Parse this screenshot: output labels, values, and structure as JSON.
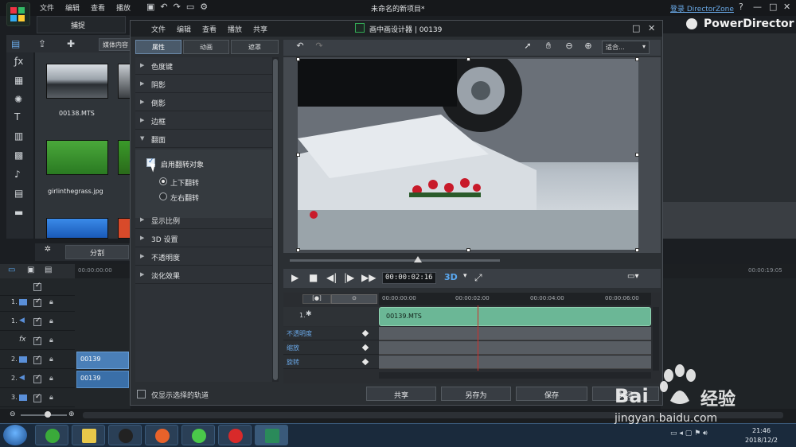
{
  "app": {
    "menu": [
      "文件",
      "编辑",
      "查看",
      "播放"
    ],
    "title": "未命名的新项目*",
    "login": "登录 DirectorZone",
    "brand": "PowerDirector",
    "help": "?",
    "minimize": "—",
    "restore": "□",
    "close": "✕",
    "capture_tab": "捕捉",
    "media_content": "媒体内容",
    "split": "分割"
  },
  "library": {
    "items": [
      {
        "label": "00138.MTS"
      },
      {
        "label": "girlinthegrass.jpg"
      }
    ]
  },
  "timeline": {
    "ruler_start": "00:00:00:00",
    "ruler_end": "00:00:19:05",
    "tracks": [
      {
        "num": "1."
      },
      {
        "num": "1."
      },
      {
        "num": ""
      },
      {
        "num": "2."
      },
      {
        "num": "2."
      },
      {
        "num": "3."
      }
    ],
    "clips": [
      "00139",
      "00139"
    ]
  },
  "dialog": {
    "menu": [
      "文件",
      "编辑",
      "查看",
      "播放",
      "共享"
    ],
    "title": "画中画设计器 | 00139",
    "tabs": [
      "属性",
      "动画",
      "遮罩"
    ],
    "properties": [
      "色度键",
      "阴影",
      "倒影",
      "边框",
      "翻面",
      "显示比例",
      "3D 设置",
      "不透明度",
      "淡化效果"
    ],
    "flip": {
      "enable_label": "启用翻转对象",
      "options": [
        "上下翻转",
        "左右翻转"
      ]
    },
    "only_selected_label": "仅显示选择的轨道",
    "preview": {
      "fit_label": "适合...",
      "timecode": "00:00:02:16",
      "mode_3d": "3D"
    },
    "keyframe": {
      "times": [
        "00:00:00:00",
        "00:00:02:00",
        "00:00:04:00",
        "00:00:06:00"
      ],
      "track_name": "1.",
      "clip_label": "00139.MTS",
      "rows": [
        "不透明度",
        "缩放",
        "旋转"
      ]
    },
    "buttons": {
      "share": "共享",
      "save_as": "另存为",
      "save": "保存",
      "close": "关闭"
    }
  },
  "taskbar": {
    "time": "21:46",
    "date": "2018/12/2"
  },
  "watermark": {
    "brand": "Bai",
    "suffix": "经验",
    "url": "jingyan.baidu.com"
  }
}
